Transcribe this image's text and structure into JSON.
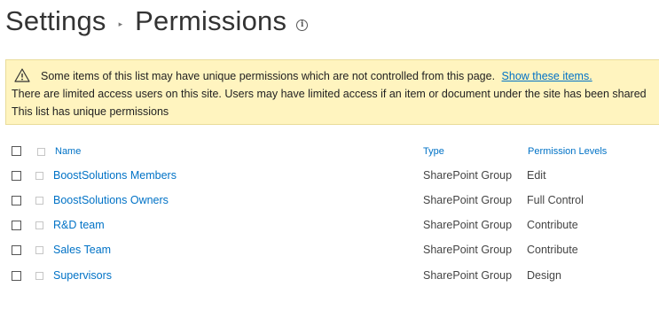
{
  "header": {
    "crumb1": "Settings",
    "separator": "▸",
    "crumb2": "Permissions",
    "info_glyph": "i"
  },
  "banner": {
    "icon": "warning-icon",
    "line1_text": "Some items of this list may have unique permissions which are not controlled from this page.",
    "line1_link": "Show these items.",
    "line2_text": "There are limited access users on this site. Users may have limited access if an item or document under the site has been shared",
    "line3_text": "This list has unique permissions",
    "background": "#fff4bf"
  },
  "table": {
    "columns": {
      "name": "Name",
      "type": "Type",
      "permission": "Permission Levels"
    },
    "rows": [
      {
        "name": "BoostSolutions Members",
        "type": "SharePoint Group",
        "permission": "Edit"
      },
      {
        "name": "BoostSolutions Owners",
        "type": "SharePoint Group",
        "permission": "Full Control"
      },
      {
        "name": "R&D team",
        "type": "SharePoint Group",
        "permission": "Contribute"
      },
      {
        "name": "Sales Team",
        "type": "SharePoint Group",
        "permission": "Contribute"
      },
      {
        "name": "Supervisors",
        "type": "SharePoint Group",
        "permission": "Design"
      }
    ]
  },
  "colors": {
    "link": "#0072c6",
    "text": "#444444"
  }
}
